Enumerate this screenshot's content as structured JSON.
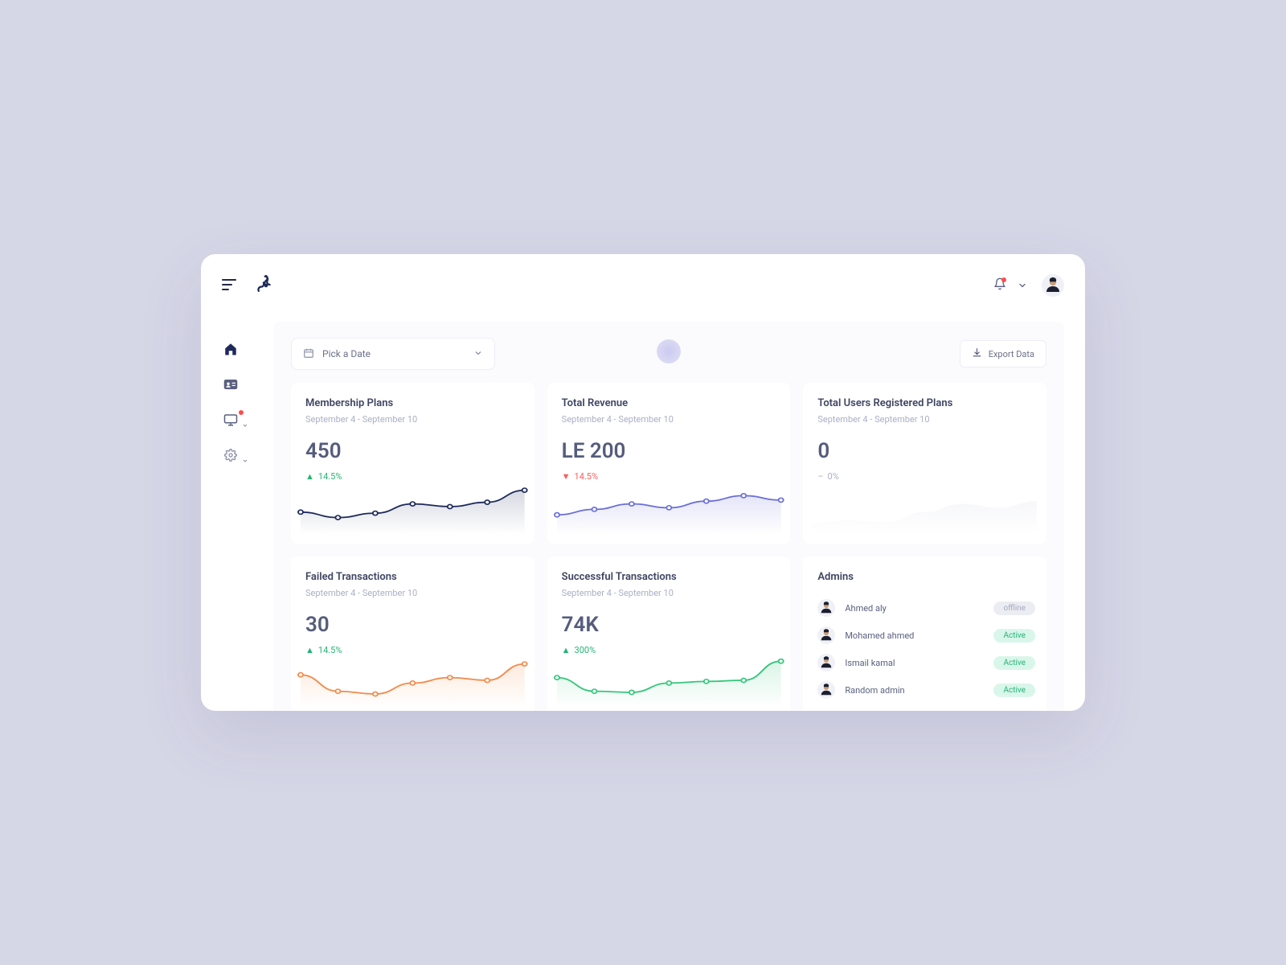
{
  "colors": {
    "navy": "#1e2a5a",
    "indigo": "#6b6fd8",
    "orange": "#f28b4b",
    "green": "#34c77b",
    "muted": "#cfd2e3"
  },
  "header": {
    "menu_icon": "menu",
    "bell_icon": "bell",
    "avatar_label": "current-user"
  },
  "sidebar": {
    "items": [
      {
        "icon": "home",
        "active": true,
        "has_badge": false,
        "has_caret": false
      },
      {
        "icon": "id-card",
        "active": false,
        "has_badge": false,
        "has_caret": false
      },
      {
        "icon": "monitor",
        "active": false,
        "has_badge": true,
        "has_caret": true
      },
      {
        "icon": "gear",
        "active": false,
        "has_badge": false,
        "has_caret": true
      }
    ]
  },
  "toolbar": {
    "datepicker_label": "Pick a Date",
    "export_label": "Export Data"
  },
  "cards": [
    {
      "title": "Membership Plans",
      "subtitle": "September 4 - September 10",
      "value": "450",
      "delta": "14.5%",
      "trend": "up",
      "color": "#1e2a5a"
    },
    {
      "title": "Total Revenue",
      "subtitle": "September 4 - September 10",
      "value": "LE 200",
      "delta": "14.5%",
      "trend": "down",
      "color": "#6b6fd8"
    },
    {
      "title": "Total Users Registered Plans",
      "subtitle": "September 4 - September 10",
      "value": "0",
      "delta": "0%",
      "trend": "flat",
      "color": "#cfd2e3"
    },
    {
      "title": "Failed Transactions",
      "subtitle": "September 4 - September 10",
      "value": "30",
      "delta": "14.5%",
      "trend": "up",
      "color": "#f28b4b"
    },
    {
      "title": "Successful Transactions",
      "subtitle": "September 4 - September 10",
      "value": "74K",
      "delta": "300%",
      "trend": "up",
      "color": "#34c77b"
    }
  ],
  "admins": {
    "title": "Admins",
    "list": [
      {
        "name": "Ahmed aly",
        "status": "offline"
      },
      {
        "name": "Mohamed ahmed",
        "status": "Active"
      },
      {
        "name": "Ismail kamal",
        "status": "Active"
      },
      {
        "name": "Random admin",
        "status": "Active"
      }
    ]
  },
  "chart_data": [
    {
      "type": "line",
      "title": "Membership Plans",
      "x": [
        0,
        1,
        2,
        3,
        4,
        5,
        6
      ],
      "values": [
        40,
        30,
        38,
        55,
        50,
        58,
        80
      ],
      "ylim": [
        0,
        100
      ]
    },
    {
      "type": "line",
      "title": "Total Revenue",
      "x": [
        0,
        1,
        2,
        3,
        4,
        5,
        6
      ],
      "values": [
        35,
        45,
        55,
        48,
        60,
        70,
        62
      ],
      "ylim": [
        0,
        100
      ]
    },
    {
      "type": "area",
      "title": "Total Users Registered Plans",
      "x": [
        0,
        1,
        2,
        3,
        4,
        5,
        6
      ],
      "values": [
        20,
        25,
        22,
        40,
        55,
        48,
        60
      ],
      "ylim": [
        0,
        100
      ]
    },
    {
      "type": "line",
      "title": "Failed Transactions",
      "x": [
        0,
        1,
        2,
        3,
        4,
        5,
        6
      ],
      "values": [
        60,
        30,
        25,
        45,
        55,
        50,
        80
      ],
      "ylim": [
        0,
        100
      ]
    },
    {
      "type": "line",
      "title": "Successful Transactions",
      "x": [
        0,
        1,
        2,
        3,
        4,
        5,
        6
      ],
      "values": [
        55,
        30,
        28,
        45,
        48,
        50,
        85
      ],
      "ylim": [
        0,
        100
      ]
    }
  ]
}
